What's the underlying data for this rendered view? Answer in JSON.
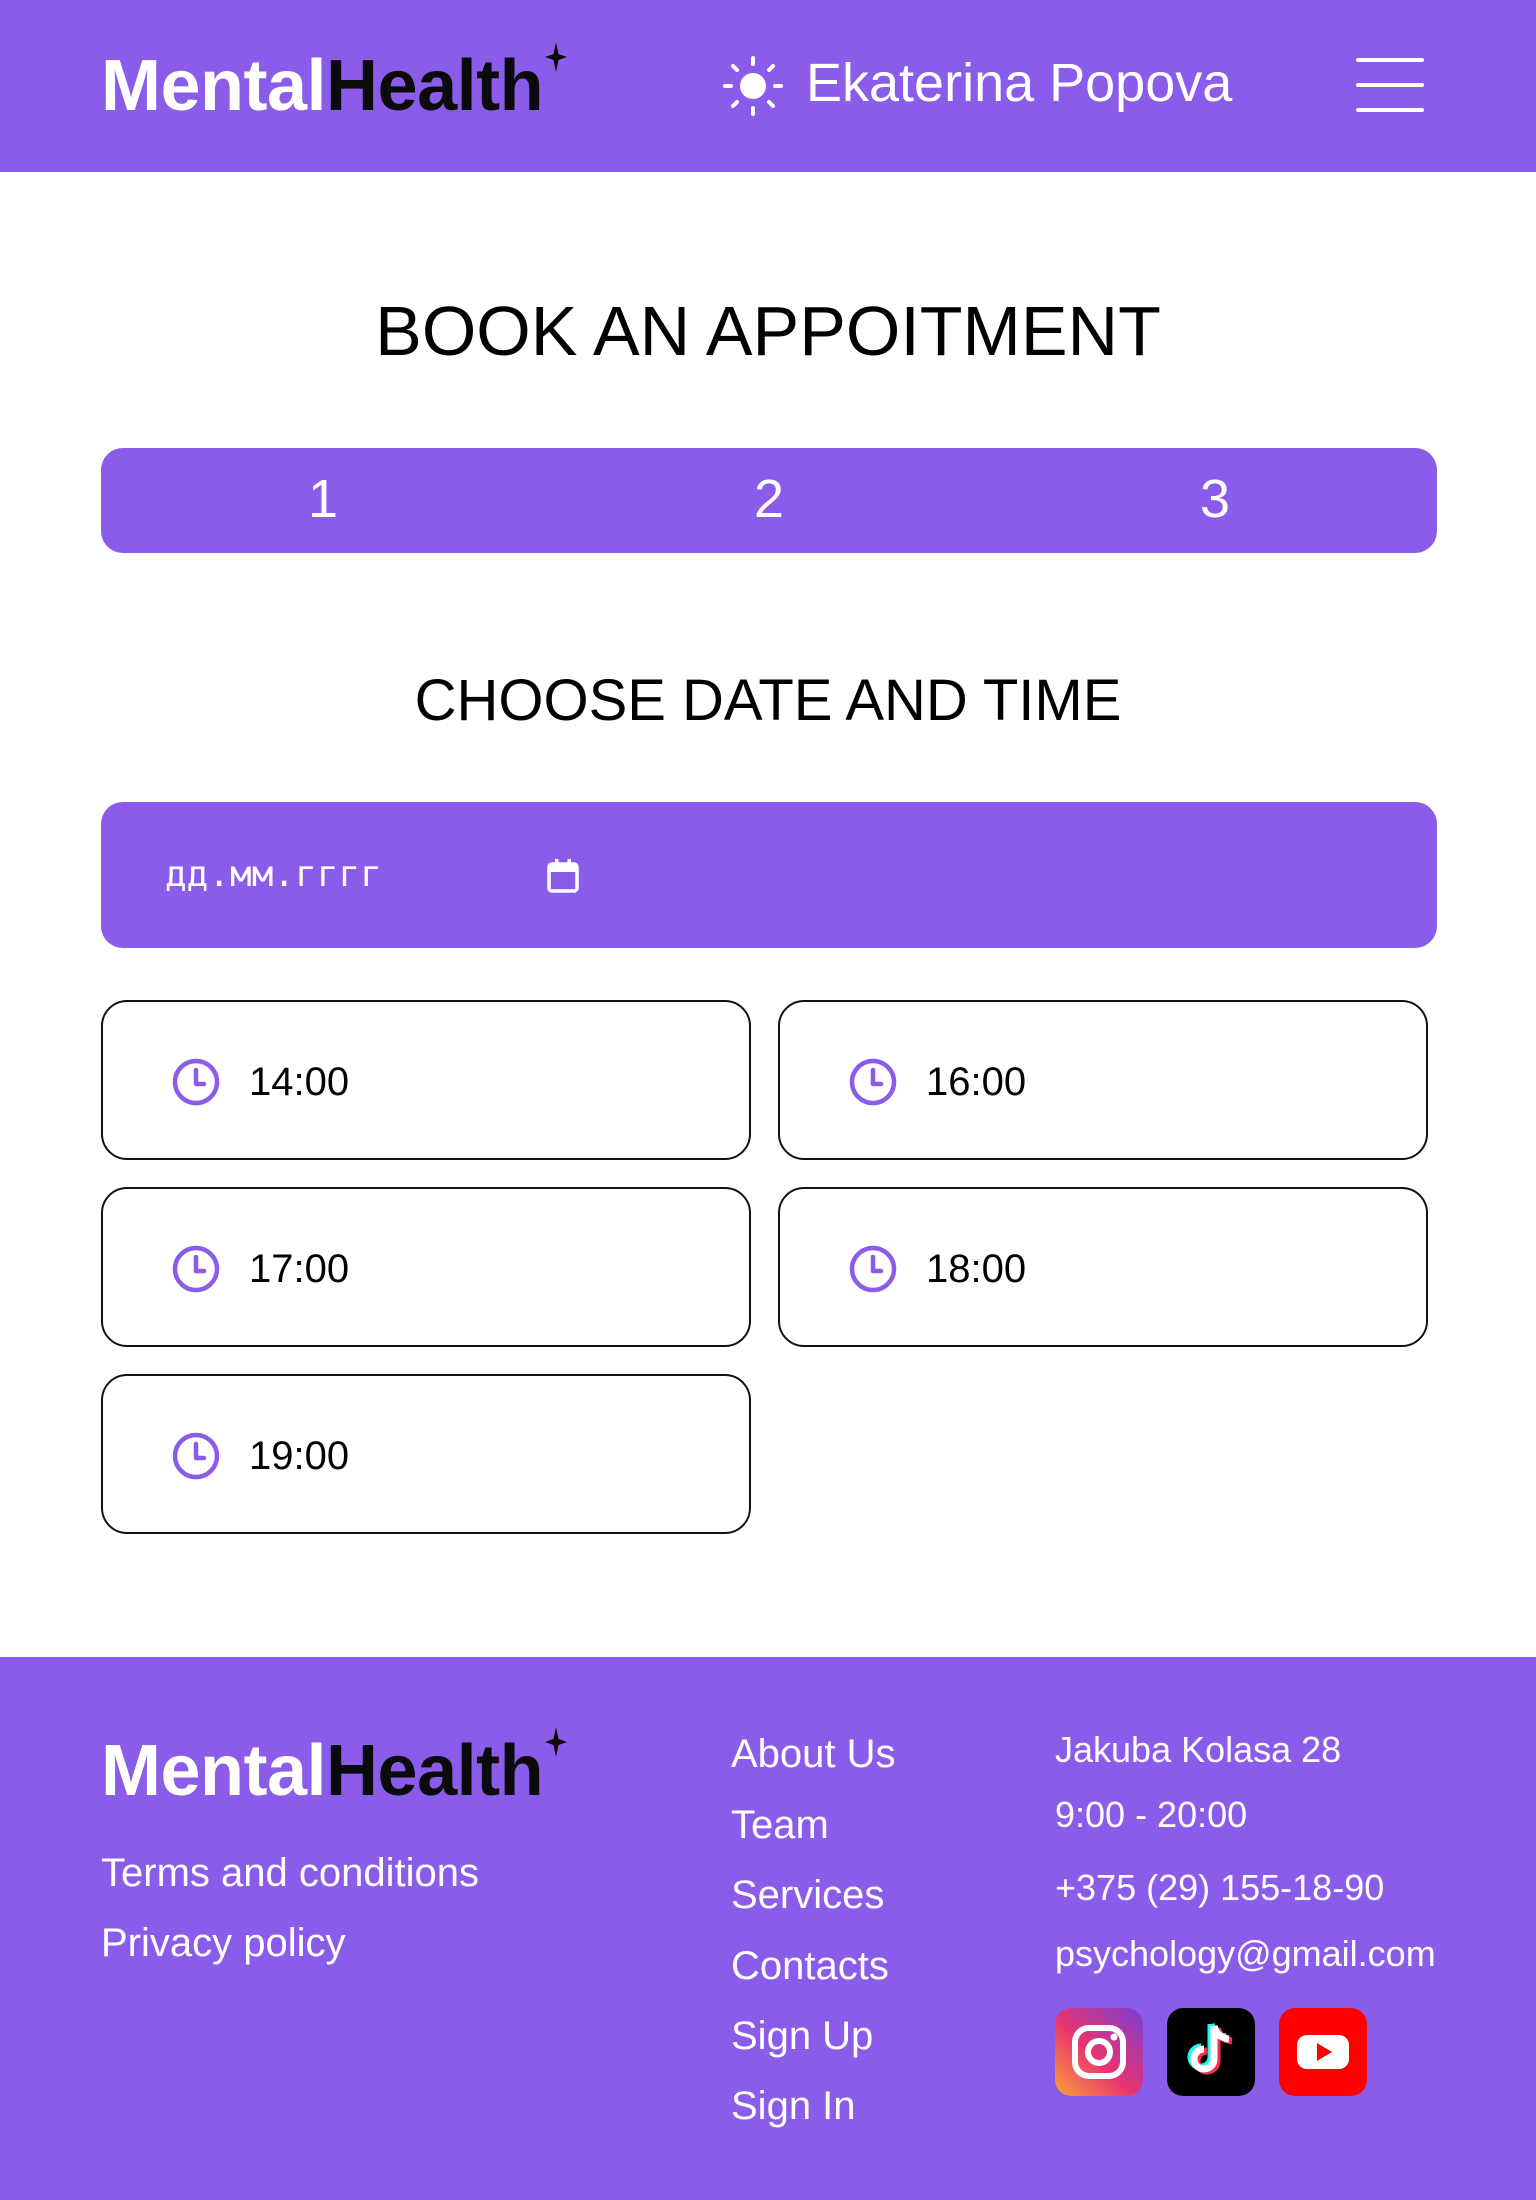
{
  "brand": {
    "part1": "Mental",
    "part2": "Health"
  },
  "header": {
    "user_name": "Ekaterina Popova",
    "theme_icon": "sun-icon",
    "menu_icon": "hamburger-menu-icon"
  },
  "main": {
    "title": "BOOK AN APPOITMENT",
    "steps": [
      "1",
      "2",
      "3"
    ],
    "subtitle": "CHOOSE DATE AND TIME",
    "date_placeholder": "дд.мм.гггг",
    "time_slots": [
      "14:00",
      "16:00",
      "17:00",
      "18:00",
      "19:00"
    ]
  },
  "footer": {
    "legal": [
      "Terms and conditions",
      "Privacy policy"
    ],
    "nav": [
      "About Us",
      "Team",
      "Services",
      "Contacts",
      "Sign Up",
      "Sign In"
    ],
    "info": {
      "address": "Jakuba Kolasa 28",
      "hours": "9:00 - 20:00",
      "phone": "+375 (29) 155-18-90",
      "email": "psychology@gmail.com"
    },
    "social": [
      "instagram-icon",
      "tiktok-icon",
      "youtube-icon"
    ]
  },
  "colors": {
    "accent": "#8b5cea",
    "clock": "#8b5cea"
  }
}
